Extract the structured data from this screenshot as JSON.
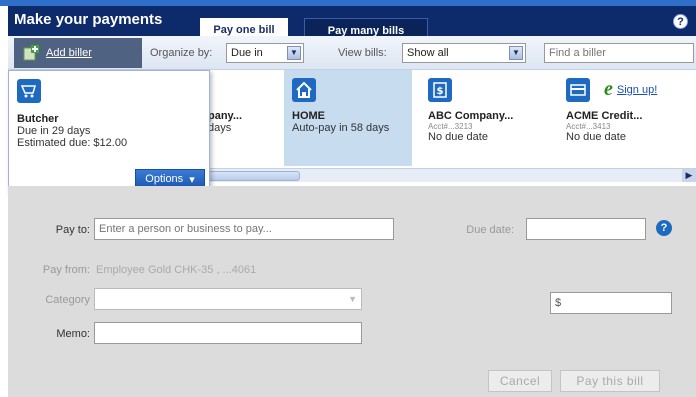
{
  "header": {
    "title": "Make your payments",
    "tabs": [
      {
        "label": "Pay one bill",
        "active": true
      },
      {
        "label": "Pay many bills",
        "active": false
      }
    ],
    "help": "?"
  },
  "toolbar": {
    "add_biller": "Add biller",
    "organize_label": "Organize by:",
    "organize_value": "Due in",
    "view_label": "View bills:",
    "view_value": "Show all",
    "find_placeholder": "Find a biller"
  },
  "popup": {
    "name": "Butcher",
    "due": "Due in 29 days",
    "estimated": "Estimated due: $12.00",
    "options_label": "Options"
  },
  "billers": [
    {
      "name": "pany...",
      "line1": "days"
    },
    {
      "name": "HOME",
      "line1": "Auto-pay in 58 days"
    },
    {
      "name": "ABC Company...",
      "acct": "Acct#...3213",
      "line1": "No due date"
    },
    {
      "name": "ACME Credit...",
      "acct": "Acct#...3413",
      "line1": "No due date",
      "signup": "Sign up!"
    }
  ],
  "form": {
    "payto_label": "Pay to:",
    "payto_placeholder": "Enter a person or business to pay...",
    "duedate_label": "Due date:",
    "payfrom_label": "Pay from:",
    "payfrom_value": "Employee Gold CHK-35 , ...4061",
    "category_label": "Category",
    "memo_label": "Memo:",
    "amount_value": "$",
    "cancel": "Cancel",
    "pay": "Pay this bill"
  },
  "colors": {
    "header_bg": "#0d2a6b",
    "accent": "#1f6ac1",
    "selected_card": "#c8dcf0",
    "form_bg": "#dcdcdc"
  }
}
